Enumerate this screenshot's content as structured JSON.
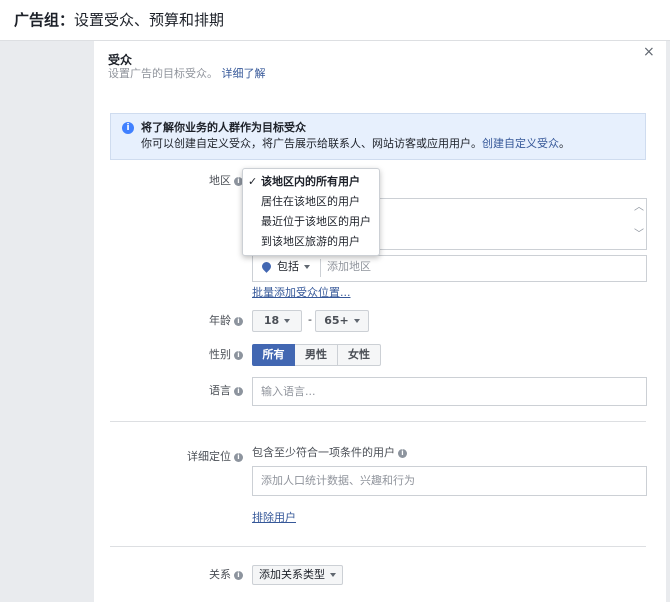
{
  "header": {
    "title_prefix": "广告组：",
    "title": "设置受众、预算和排期"
  },
  "panel": {
    "close_glyph": "×",
    "section_title": "受众",
    "section_subtitle": "设置广告的目标受众。",
    "learn_more": "详细了解"
  },
  "info": {
    "title": "将了解你业务的人群作为目标受众",
    "text": "你可以创建自定义受众，将广告展示给联系人、网站访客或应用用户。",
    "link": "创建自定义受众",
    "text_end": "。"
  },
  "location": {
    "label": "地区",
    "dropdown": {
      "selected_index": 0,
      "options": [
        "该地区内的所有用户",
        "居住在该地区的用户",
        "最近位于该地区的用户",
        "到该地区旅游的用户"
      ]
    },
    "include_label": "包括",
    "placeholder": "添加地区",
    "bulk_link": "批量添加受众位置..."
  },
  "age": {
    "label": "年龄",
    "min": "18",
    "dash": "-",
    "max": "65+"
  },
  "gender": {
    "label": "性别",
    "options": [
      "所有",
      "男性",
      "女性"
    ],
    "selected_index": 0
  },
  "language": {
    "label": "语言",
    "placeholder": "输入语言..."
  },
  "detailed": {
    "label": "详细定位",
    "hint": "包含至少符合一项条件的用户",
    "placeholder": "添加人口统计数据、兴趣和行为",
    "exclude_link": "排除用户"
  },
  "connections": {
    "label": "关系",
    "button": "添加关系类型"
  },
  "colors": {
    "accent": "#4267b2",
    "link": "#365899",
    "info_bg": "#e7f0fd"
  }
}
